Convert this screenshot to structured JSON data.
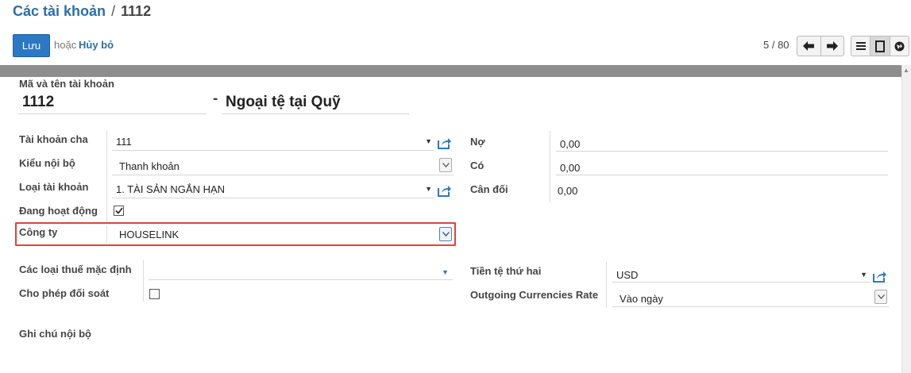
{
  "header": {
    "breadcrumb_parent": "Các tài khoản",
    "breadcrumb_sep": "/",
    "breadcrumb_current": "1112"
  },
  "toolbar": {
    "save_label": "Lưu",
    "or_text": "hoặc",
    "discard_label": "Hủy bỏ",
    "pager": "5 / 80"
  },
  "form": {
    "code_name_label": "Mã và tên tài khoản",
    "code": "1112",
    "dash": "-",
    "name": "Ngoại tệ tại Quỹ",
    "parent_label": "Tài khoản cha",
    "parent_value": "111",
    "internal_type_label": "Kiểu nội bộ",
    "internal_type_value": "Thanh khoản",
    "account_type_label": "Loại tài khoản",
    "account_type_value": "1. TÀI SẢN NGẮN HẠN",
    "active_label": "Đang hoạt động",
    "active_checked": true,
    "company_label": "Công ty",
    "company_value": "HOUSELINK",
    "debit_label": "Nợ",
    "debit_value": "0,00",
    "credit_label": "Có",
    "credit_value": "0,00",
    "balance_label": "Cân đối",
    "balance_value": "0,00",
    "default_taxes_label": "Các loại thuế mặc định",
    "default_taxes_value": "",
    "reconcile_label": "Cho phép đối soát",
    "reconcile_checked": false,
    "second_currency_label": "Tiền tệ thứ hai",
    "second_currency_value": "USD",
    "outgoing_rate_label": "Outgoing Currencies Rate",
    "outgoing_rate_value": "Vào ngày",
    "internal_notes_label": "Ghi chú nội bộ"
  },
  "colors": {
    "primary": "#2b78c5",
    "link": "#2a6fa8",
    "highlight": "#d9463b"
  },
  "icons": {
    "external_link": "external-link-icon",
    "prev": "arrow-left-icon",
    "next": "arrow-right-icon",
    "list_view": "list-view-icon",
    "form_view": "form-view-icon",
    "kanban_view": "kanban-view-icon"
  }
}
